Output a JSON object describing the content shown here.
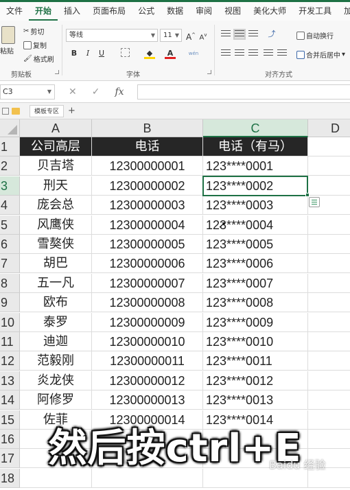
{
  "ribbon": {
    "tabs": [
      "文件",
      "开始",
      "插入",
      "页面布局",
      "公式",
      "数据",
      "审阅",
      "视图",
      "美化大师",
      "开发工具",
      "加载"
    ],
    "active_tab_index": 1,
    "clipboard": {
      "paste": "粘贴",
      "cut": "剪切",
      "copy": "复制",
      "format_painter": "格式刷",
      "group_label": "剪贴板"
    },
    "font": {
      "family": "等线",
      "size": "11",
      "bold": "B",
      "italic": "I",
      "underline": "U",
      "group_label": "字体"
    },
    "alignment": {
      "wrap_text": "自动换行",
      "merge_center": "合并后居中",
      "group_label": "对齐方式"
    }
  },
  "formula_bar": {
    "name_box": "C3",
    "cancel": "✕",
    "confirm": "✓",
    "fx": "fx",
    "content": ""
  },
  "sheet_strip": {
    "tab_label": "模板专区",
    "add": "+"
  },
  "grid": {
    "columns": [
      "A",
      "B",
      "C",
      "D"
    ],
    "rows": [
      "1",
      "2",
      "3",
      "4",
      "5",
      "6",
      "7",
      "8",
      "9",
      "10",
      "11",
      "12",
      "13",
      "14",
      "15",
      "16",
      "17",
      "18"
    ],
    "header": [
      "公司高层",
      "电话",
      "电话（有马）"
    ],
    "data": [
      [
        "贝吉塔",
        "12300000001",
        "123****0001"
      ],
      [
        "刑天",
        "12300000002",
        "123****0002"
      ],
      [
        "庞会总",
        "12300000003",
        "123****0003"
      ],
      [
        "风鹰侠",
        "12300000004",
        "123****0004"
      ],
      [
        "雪獒侠",
        "12300000005",
        "123****0005"
      ],
      [
        "胡巴",
        "12300000006",
        "123****0006"
      ],
      [
        "五一凡",
        "12300000007",
        "123****0007"
      ],
      [
        "欧布",
        "12300000008",
        "123****0008"
      ],
      [
        "泰罗",
        "12300000009",
        "123****0009"
      ],
      [
        "迪迦",
        "12300000010",
        "123****0010"
      ],
      [
        "范毅刚",
        "12300000011",
        "123****0011"
      ],
      [
        "炎龙侠",
        "12300000012",
        "123****0012"
      ],
      [
        "阿修罗",
        "12300000013",
        "123****0013"
      ],
      [
        "佐菲",
        "12300000014",
        "123****0014"
      ]
    ],
    "active_cell": "C3"
  },
  "caption": "然后按ctrl+E",
  "watermark": "Baidu 经验",
  "colors": {
    "accent": "#1e7145",
    "header_fill": "#262626",
    "header_text": "#ffffff"
  }
}
